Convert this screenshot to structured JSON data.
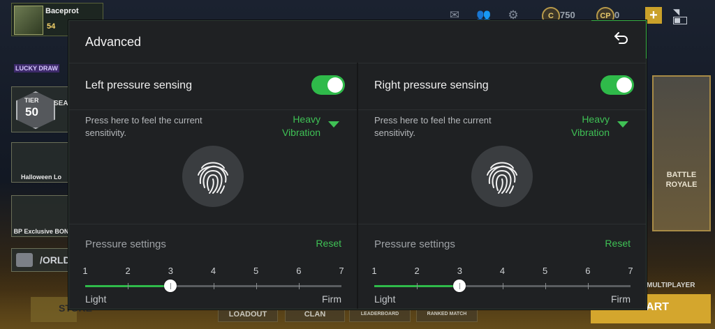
{
  "game": {
    "player_name": "Baceprot",
    "player_level": "54",
    "currency_cp": "0",
    "currency_credits": "750",
    "lucky_draw_label": "LUCKY DRAW",
    "tier_label": "TIER",
    "tier_value": "50",
    "season_label": "SEAS",
    "event_label": "Halloween Lo",
    "bp_label": "BP Exclusive BON",
    "chat_label": "/ORLD",
    "battle_royale_label": "BATTLE ROYALE",
    "multiplayer_label": "MULTIPLAYER",
    "start_label": "START",
    "store_label": "STORE",
    "bottom_nav": [
      "LOADOUT",
      "CLAN",
      "LEADERBOARD",
      "RANKED MATCH"
    ]
  },
  "dialog": {
    "title": "Advanced",
    "accent_color": "#3fc155"
  },
  "left_panel": {
    "title": "Left pressure sensing",
    "enabled": true,
    "hint": "Press here to feel the current sensitivity.",
    "vibration": "Heavy Vibration",
    "pressure_label": "Pressure settings",
    "reset_label": "Reset",
    "scale": [
      "1",
      "2",
      "3",
      "4",
      "5",
      "6",
      "7"
    ],
    "value": 3,
    "min_label": "Light",
    "max_label": "Firm"
  },
  "right_panel": {
    "title": "Right pressure sensing",
    "enabled": true,
    "hint": "Press here to feel the current sensitivity.",
    "vibration": "Heavy Vibration",
    "pressure_label": "Pressure settings",
    "reset_label": "Reset",
    "scale": [
      "1",
      "2",
      "3",
      "4",
      "5",
      "6",
      "7"
    ],
    "value": 3,
    "min_label": "Light",
    "max_label": "Firm"
  }
}
